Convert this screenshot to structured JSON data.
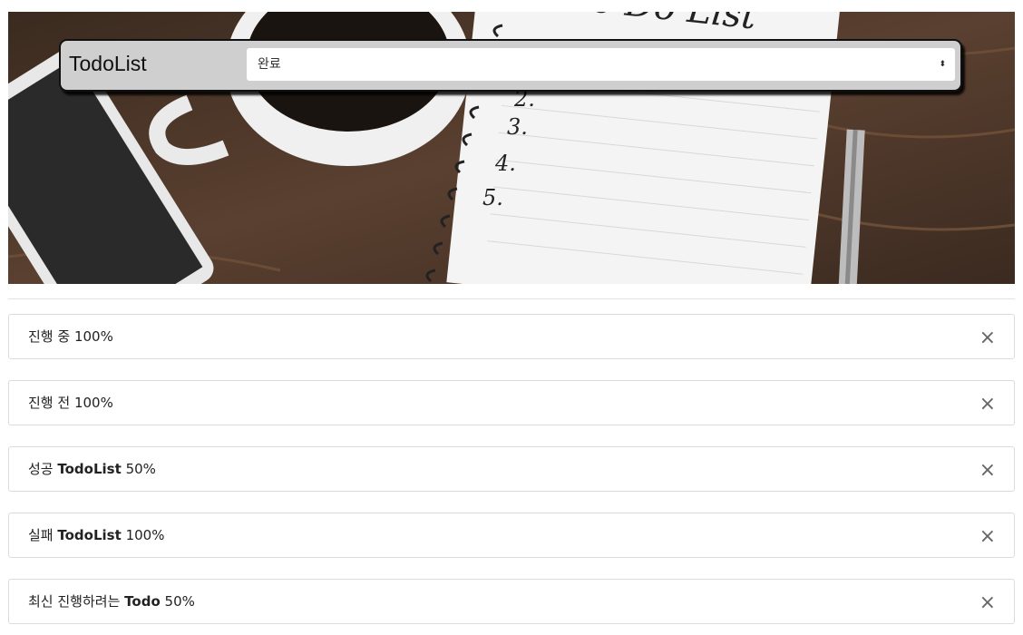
{
  "header": {
    "brand": "TodoList",
    "filter_value": "완료"
  },
  "todos": [
    {
      "prefix": "진행 중",
      "bold": "",
      "percent": "100%"
    },
    {
      "prefix": "진행 전",
      "bold": "",
      "percent": "100%"
    },
    {
      "prefix": "성공",
      "bold": "TodoList",
      "percent": "50%"
    },
    {
      "prefix": "실패",
      "bold": "TodoList",
      "percent": "100%"
    },
    {
      "prefix": "최신 진행하려는",
      "bold": "Todo",
      "percent": "50%"
    }
  ],
  "hero_notebook": {
    "title": "To Do List",
    "numbers": [
      "2.",
      "3.",
      "4.",
      "5."
    ]
  },
  "colors": {
    "navbar_bg": "#cfcfcf",
    "desk": "#4a3526",
    "item_border": "#dcdcdc"
  },
  "icons": {
    "close": "×",
    "select_arrow": "⬍"
  }
}
